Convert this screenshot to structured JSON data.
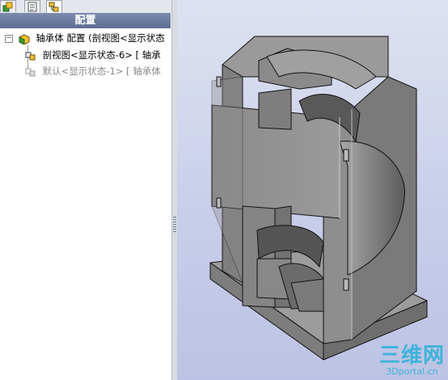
{
  "tabs": [
    {
      "icon": "feature-manager-icon"
    },
    {
      "icon": "property-manager-icon"
    },
    {
      "icon": "configuration-manager-icon"
    }
  ],
  "panel": {
    "title": "配置",
    "tree": {
      "root_label": "轴承体 配置  (剖视图<显示状态",
      "items": [
        {
          "label": "剖视图<显示状态-6> [ 轴承",
          "active": true
        },
        {
          "label": "默认<显示状态-1> [ 轴承体",
          "active": false
        }
      ]
    }
  },
  "viewport": {
    "model": "bearing-housing-section-view",
    "watermark_main": "三维网",
    "watermark_sub": "3Dportal.cn"
  },
  "colors": {
    "header": "#6a7a9f",
    "viewport_bg": "#c7cde9",
    "model_face": "#8c8c8c",
    "watermark": "#3fb3d9"
  }
}
